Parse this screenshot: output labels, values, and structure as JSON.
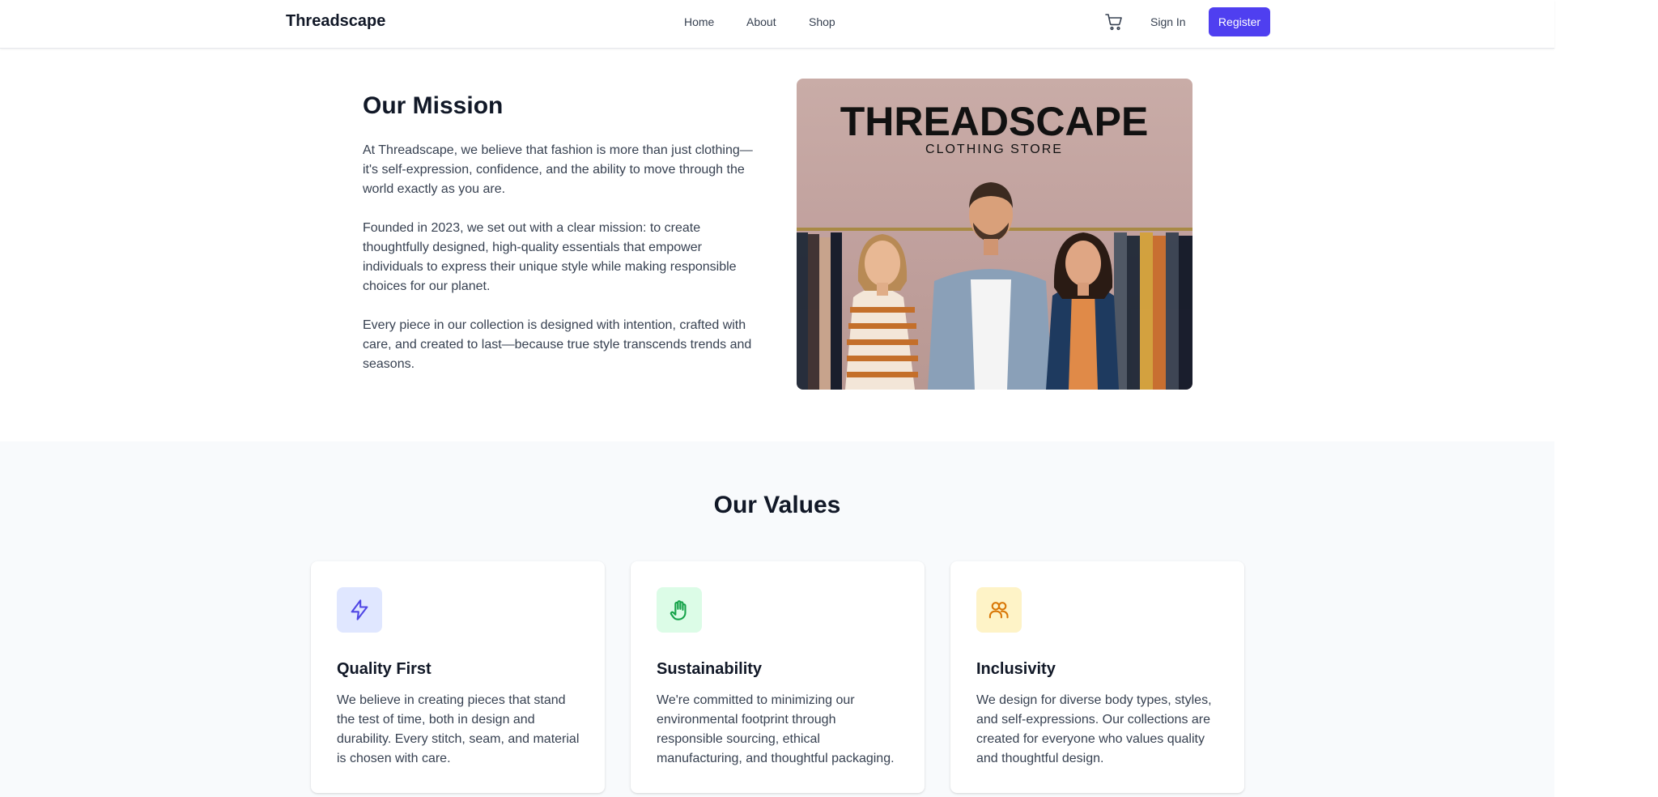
{
  "header": {
    "brand": "Threadscape",
    "nav": [
      "Home",
      "About",
      "Shop"
    ],
    "sign_in": "Sign In",
    "register": "Register"
  },
  "mission": {
    "title": "Our Mission",
    "paragraphs": [
      "At Threadscape, we believe that fashion is more than just clothing—it's self-expression, confidence, and the ability to move through the world exactly as you are.",
      "Founded in 2023, we set out with a clear mission: to create thoughtfully designed, high-quality essentials that empower individuals to express their unique style while making responsible choices for our planet.",
      "Every piece in our collection is designed with intention, crafted with care, and created to last—because true style transcends trends and seasons."
    ],
    "image": {
      "logo_title": "THREADSCAPE",
      "logo_subtitle": "CLOTHING STORE"
    }
  },
  "values": {
    "title": "Our Values",
    "cards": [
      {
        "title": "Quality First",
        "icon": "lightning-icon",
        "accent": "#4f46e5",
        "bg": "#e0e7ff",
        "text": "We believe in creating pieces that stand the test of time, both in design and durability. Every stitch, seam, and material is chosen with care."
      },
      {
        "title": "Sustainability",
        "icon": "hand-icon",
        "accent": "#16a34a",
        "bg": "#dcfce7",
        "text": "We're committed to minimizing our environmental footprint through responsible sourcing, ethical manufacturing, and thoughtful packaging."
      },
      {
        "title": "Inclusivity",
        "icon": "users-icon",
        "accent": "#d97706",
        "bg": "#fef3c7",
        "text": "We design for diverse body types, styles, and self-expressions. Our collections are created for everyone who values quality and thoughtful design."
      }
    ]
  },
  "colors": {
    "primary": "#4f3ff0",
    "section_bg": "#f8fafc"
  }
}
